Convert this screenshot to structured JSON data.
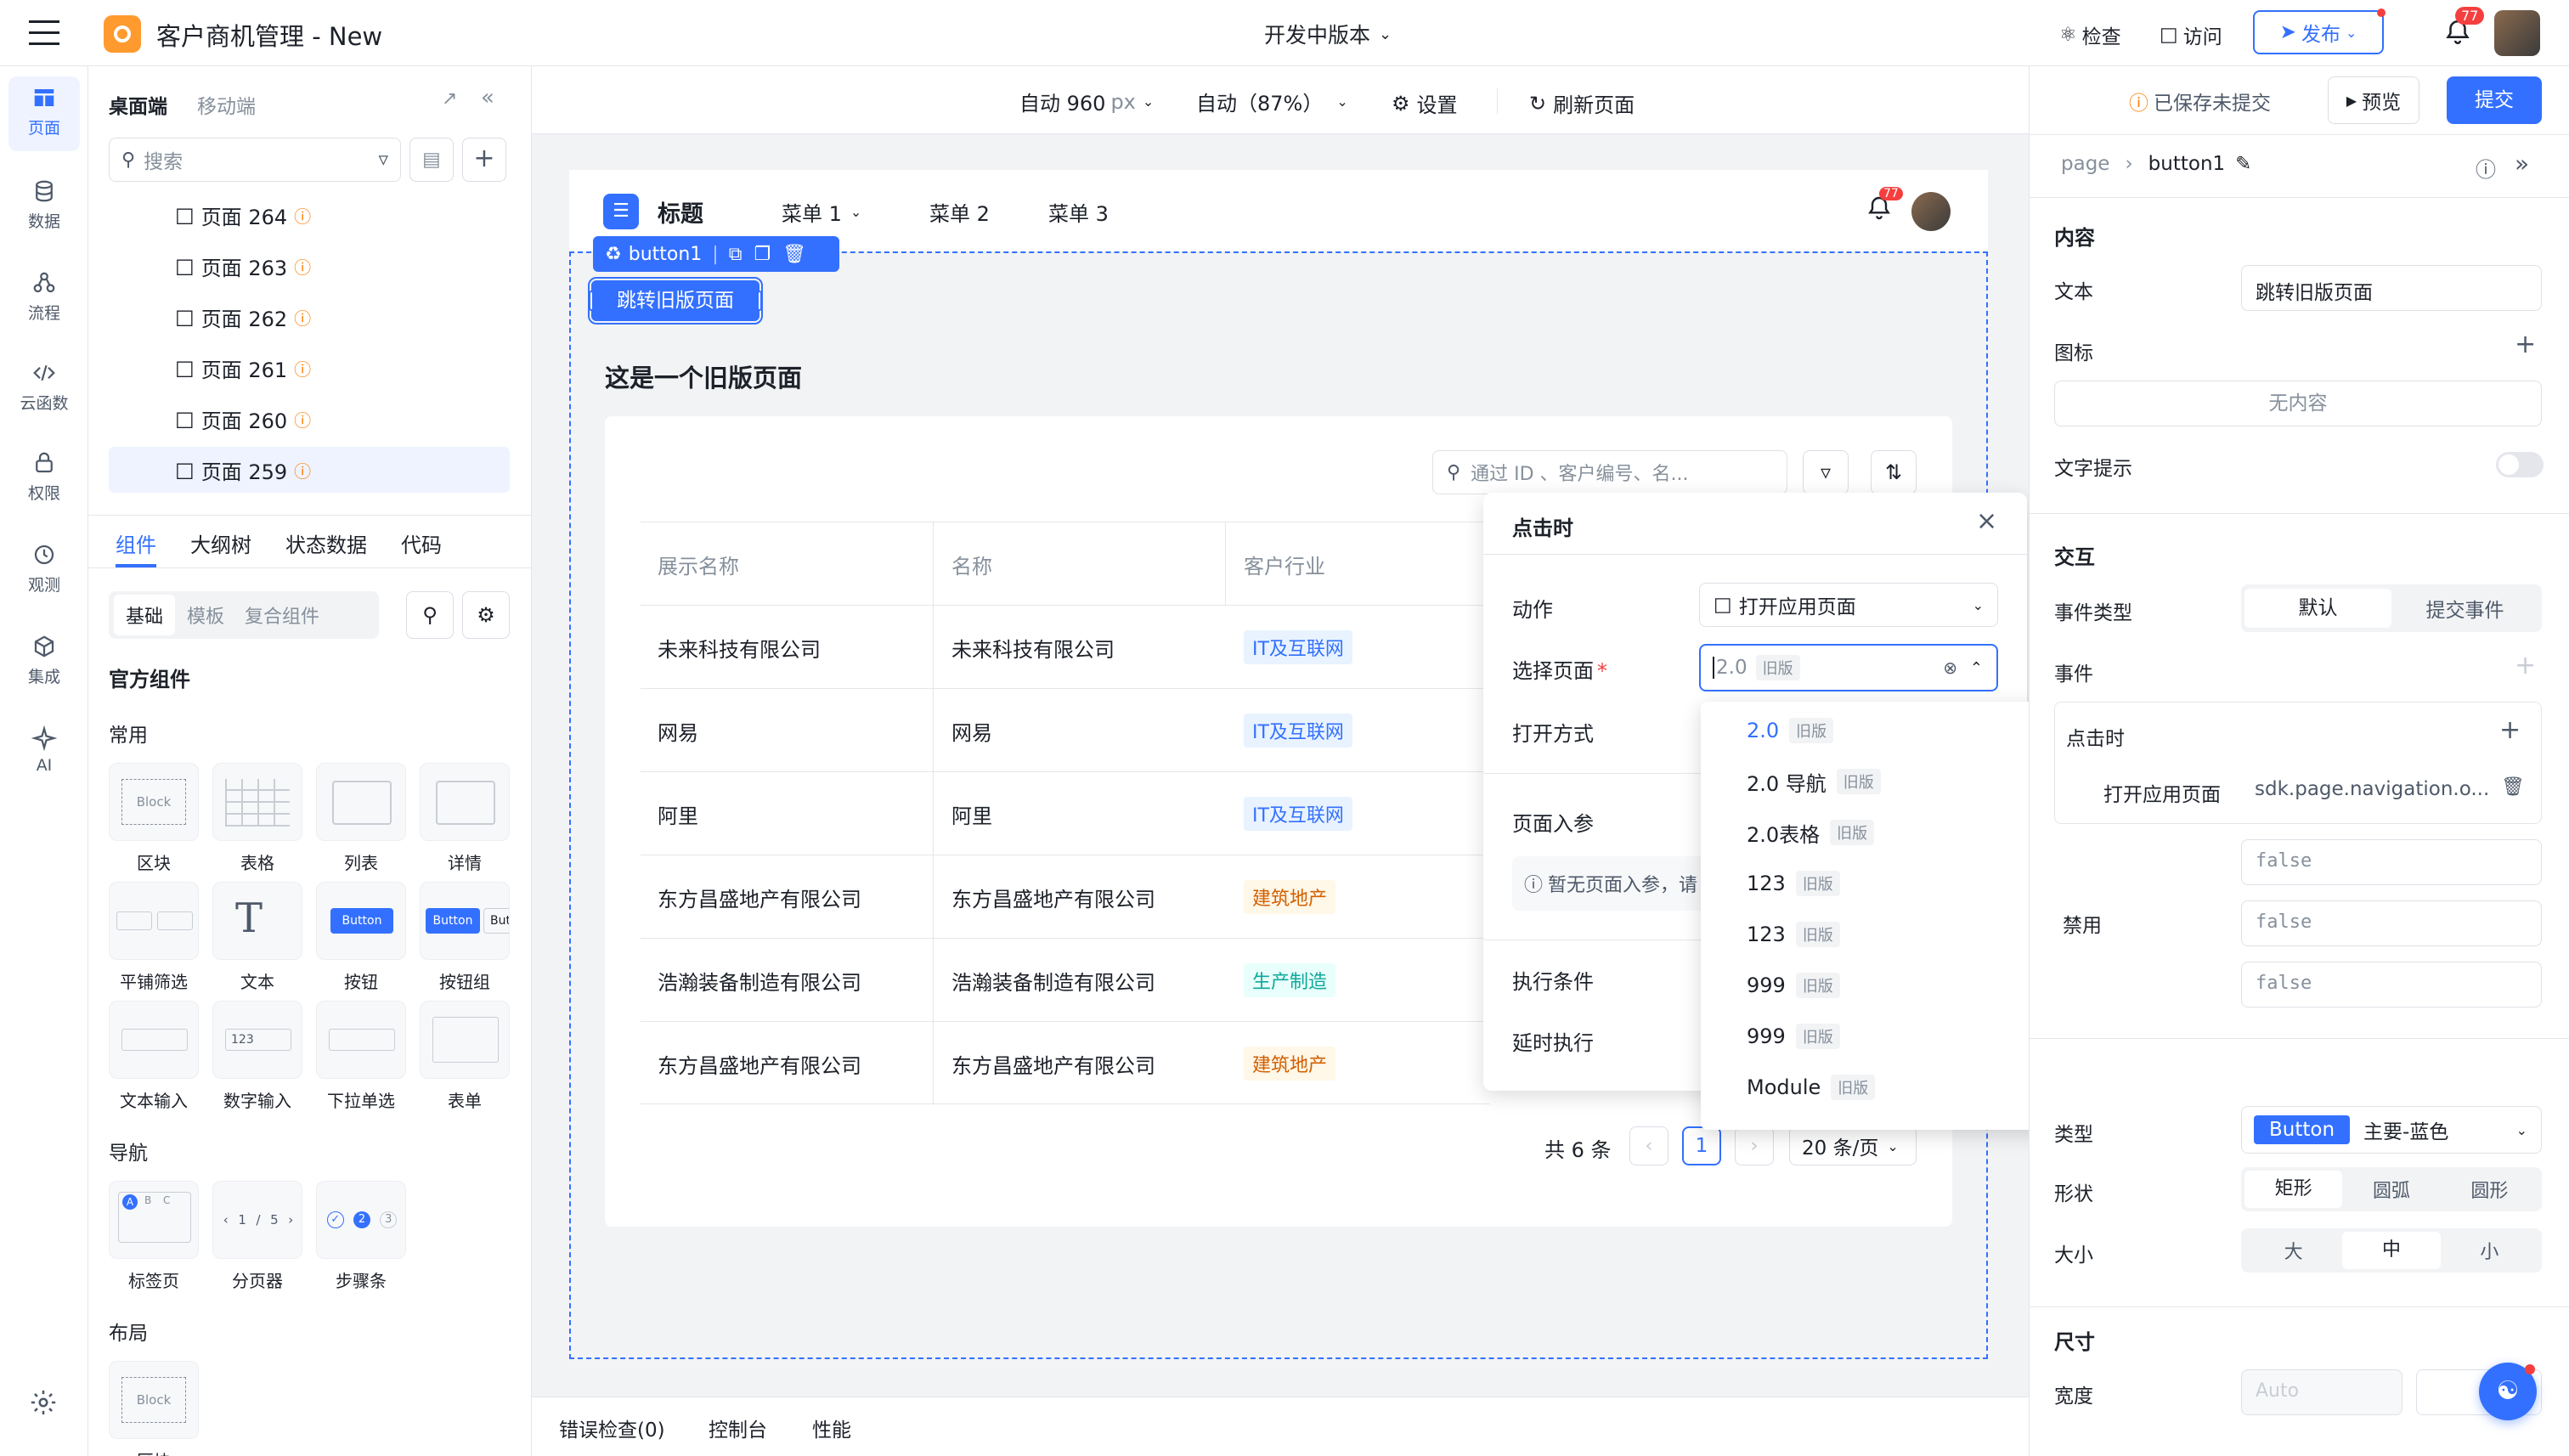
{
  "app": {
    "title": "客户商机管理 - New",
    "version": "开发中版本",
    "inspect": "检查",
    "visit": "访问",
    "publish": "发布",
    "notif_count": "77"
  },
  "rail": [
    {
      "label": "页面",
      "icon": "pages-icon"
    },
    {
      "label": "数据",
      "icon": "database-icon"
    },
    {
      "label": "流程",
      "icon": "flow-icon"
    },
    {
      "label": "云函数",
      "icon": "code-icon"
    },
    {
      "label": "权限",
      "icon": "lock-icon"
    },
    {
      "label": "观测",
      "icon": "monitor-icon"
    },
    {
      "label": "集成",
      "icon": "cube-icon"
    },
    {
      "label": "AI",
      "icon": "sparkle-icon"
    }
  ],
  "left": {
    "tabs": [
      "桌面端",
      "移动端"
    ],
    "search_placeholder": "搜索",
    "pages": [
      "页面 264",
      "页面 263",
      "页面 262",
      "页面 261",
      "页面 260",
      "页面 259"
    ],
    "bottom_tabs": [
      "组件",
      "大纲树",
      "状态数据",
      "代码"
    ],
    "sub_tabs": [
      "基础",
      "模板",
      "复合组件"
    ],
    "official": "官方组件",
    "groups": {
      "common": "常用",
      "nav": "导航",
      "layout": "布局"
    },
    "common_components": [
      "区块",
      "表格",
      "列表",
      "详情",
      "平铺筛选",
      "文本",
      "按钮",
      "按钮组",
      "文本输入",
      "数字输入",
      "下拉单选",
      "表单"
    ],
    "nav_components": [
      "标签页",
      "分页器",
      "步骤条"
    ],
    "layout_components": [
      "区块"
    ],
    "thumb_texts": {
      "block": "Block",
      "button": "Button",
      "button_group": [
        "Button",
        "But"
      ],
      "number": "123",
      "tabs": [
        "A",
        "B",
        "C"
      ],
      "pager": [
        "1",
        "5"
      ],
      "steps": [
        "2",
        "3"
      ]
    }
  },
  "toolbar": {
    "width": "自动 960",
    "width_unit": "px",
    "zoom": "自动（87%）",
    "settings": "设置",
    "refresh": "刷新页面",
    "saved": "已保存未提交",
    "preview": "预览",
    "submit": "提交"
  },
  "canvas": {
    "nav_title": "标题",
    "menus": [
      "菜单 1",
      "菜单 2",
      "菜单 3"
    ],
    "badge": "77",
    "selected_name": "button1",
    "button_text": "跳转旧版页面",
    "page_heading": "这是一个旧版页面",
    "search_placeholder": "通过 ID 、客户编号、名...",
    "columns": [
      "展示名称",
      "名称",
      "客户行业"
    ],
    "rows": [
      {
        "display": "未来科技有限公司",
        "name": "未来科技有限公司",
        "industry": "IT及互联网",
        "color": "#e8f3ff"
      },
      {
        "display": "网易",
        "name": "网易",
        "industry": "IT及互联网",
        "color": "#e8f3ff"
      },
      {
        "display": "阿里",
        "name": "阿里",
        "industry": "IT及互联网",
        "color": "#e8f3ff"
      },
      {
        "display": "东方昌盛地产有限公司",
        "name": "东方昌盛地产有限公司",
        "industry": "建筑地产",
        "color": "#fff7e8"
      },
      {
        "display": "浩瀚装备制造有限公司",
        "name": "浩瀚装备制造有限公司",
        "industry": "生产制造",
        "color": "#e8fffb"
      },
      {
        "display": "东方昌盛地产有限公司",
        "name": "东方昌盛地产有限公司",
        "industry": "建筑地产",
        "color": "#fff7e8"
      }
    ],
    "total": "共 6 条",
    "page": "1",
    "page_size": "20 条/页"
  },
  "event_panel": {
    "title": "点击时",
    "action_label": "动作",
    "action_value": "打开应用页面",
    "select_page_label": "选择页面",
    "select_value": "2.0",
    "select_tag": "旧版",
    "open_mode_label": "打开方式",
    "params_label": "页面入参",
    "params_hint": "暂无页面入参，请",
    "condition_label": "执行条件",
    "delay_label": "延时执行"
  },
  "dropdown": {
    "options": [
      {
        "label": "2.0",
        "tag": "旧版",
        "selected": true
      },
      {
        "label": "2.0 导航",
        "tag": "旧版"
      },
      {
        "label": "2.0表格",
        "tag": "旧版"
      },
      {
        "label": "123",
        "tag": "旧版"
      },
      {
        "label": "123",
        "tag": "旧版"
      },
      {
        "label": "999",
        "tag": "旧版"
      },
      {
        "label": "999",
        "tag": "旧版"
      },
      {
        "label": "Module",
        "tag": "旧版"
      }
    ]
  },
  "right": {
    "breadcrumb": [
      "page",
      "button1"
    ],
    "content_section": "内容",
    "text_label": "文本",
    "text_value": "跳转旧版页面",
    "icon_label": "图标",
    "icon_value": "无内容",
    "tooltip_label": "文字提示",
    "interaction_section": "交互",
    "event_type_label": "事件类型",
    "event_type_options": [
      "默认",
      "提交事件"
    ],
    "events_label": "事件",
    "event_group": "点击时",
    "event_action": "打开应用页面",
    "event_sdk": "sdk.page.navigation.o...",
    "false_values": [
      "false",
      "false",
      "false"
    ],
    "partial_label": "禁用",
    "type_label": "类型",
    "type_value": "Button",
    "type_desc": "主要-蓝色",
    "shape_label": "形状",
    "shape_options": [
      "矩形",
      "圆弧",
      "圆形"
    ],
    "size_label": "大小",
    "size_options": [
      "大",
      "中",
      "小"
    ],
    "dim_section": "尺寸",
    "width_label": "宽度",
    "width_value": "Auto"
  },
  "bottom_bar": [
    "错误检查(0)",
    "控制台",
    "性能"
  ],
  "colors": {
    "primary": "#3370ff",
    "accent_red": "#f53f3f",
    "orange": "#ff7d00"
  }
}
